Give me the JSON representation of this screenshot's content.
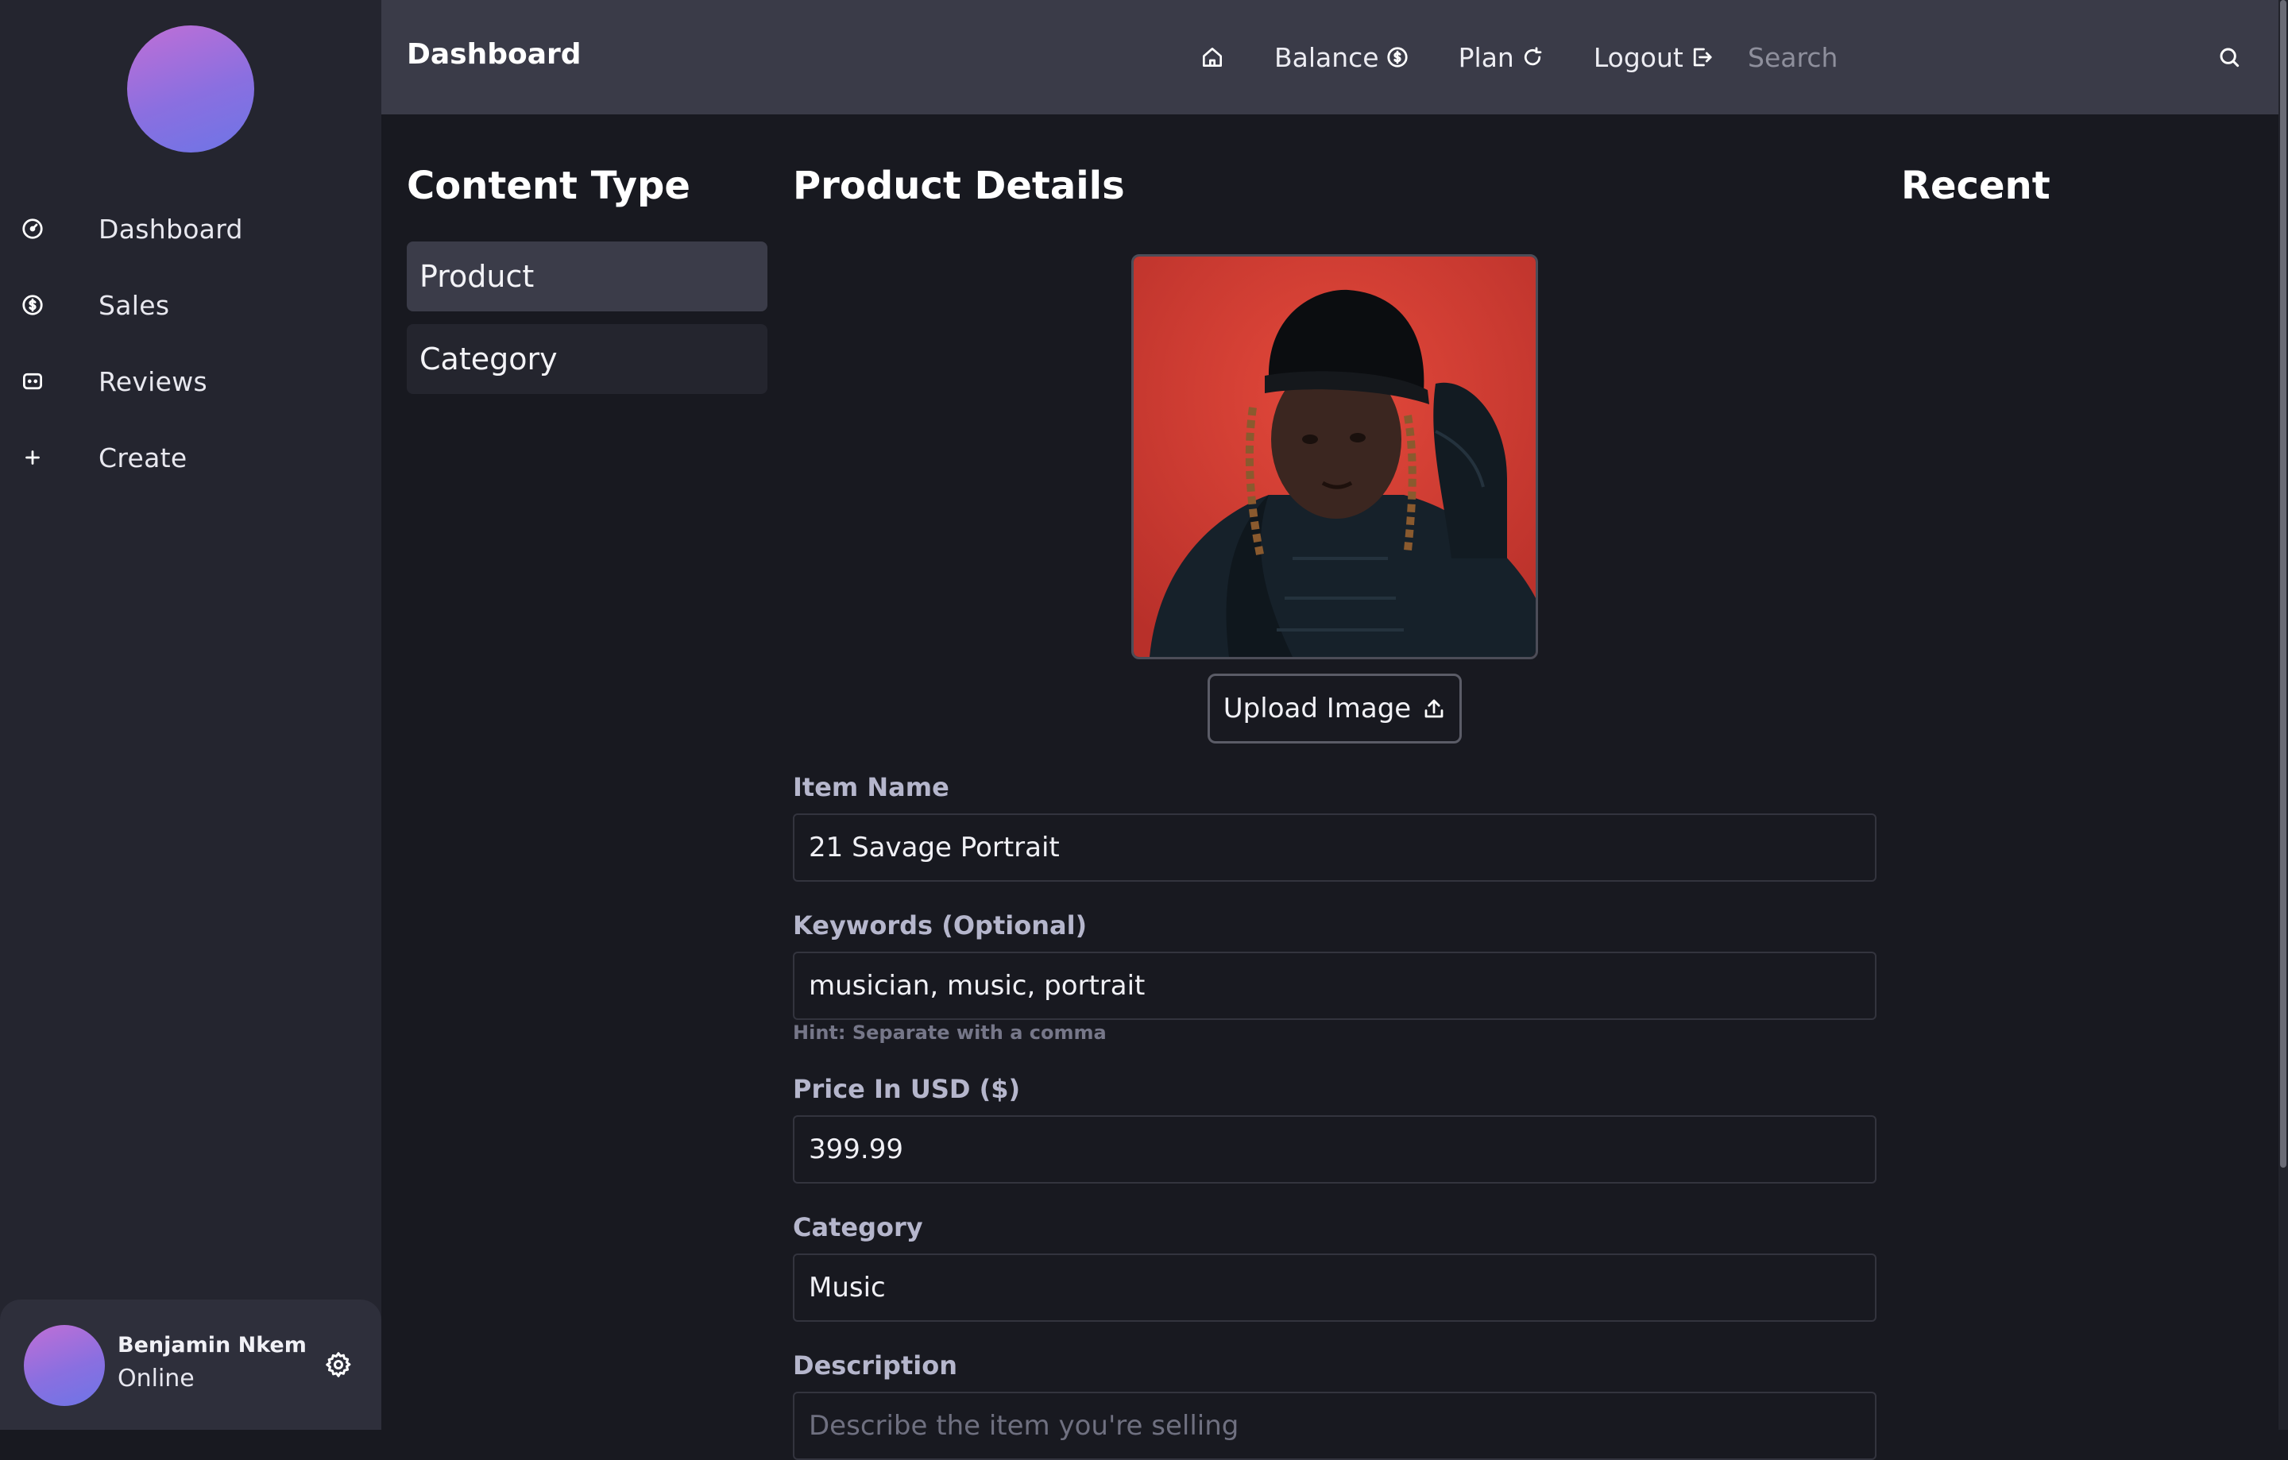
{
  "sidebar": {
    "items": [
      {
        "label": "Dashboard",
        "icon": "gauge-icon"
      },
      {
        "label": "Sales",
        "icon": "dollar-circle-icon"
      },
      {
        "label": "Reviews",
        "icon": "message-square-icon"
      },
      {
        "label": "Create",
        "icon": "plus-icon"
      }
    ],
    "user": {
      "name": "Benjamin Nkem",
      "status": "Online"
    }
  },
  "header": {
    "title": "Dashboard",
    "nav": {
      "balance": "Balance",
      "plan": "Plan",
      "logout": "Logout"
    },
    "search_placeholder": "Search"
  },
  "content_type": {
    "title": "Content Type",
    "options": [
      "Product",
      "Category"
    ],
    "selected": "Product"
  },
  "product_details": {
    "title": "Product Details",
    "upload_label": "Upload Image",
    "fields": {
      "item_name": {
        "label": "Item Name",
        "value": "21 Savage Portrait"
      },
      "keywords": {
        "label": "Keywords (Optional)",
        "value": "musician, music, portrait",
        "hint": "Hint: Separate with a comma"
      },
      "price": {
        "label": "Price In USD ($)",
        "value": "399.99"
      },
      "category": {
        "label": "Category",
        "value": "Music"
      },
      "description": {
        "label": "Description",
        "placeholder": "Describe the item you're selling"
      }
    }
  },
  "recent": {
    "title": "Recent"
  },
  "colors": {
    "background": "#181920",
    "sidebar": "#24252f",
    "topbar": "#3a3b48",
    "accent_gradient_start": "#c06fd6",
    "accent_gradient_end": "#6d75e6",
    "label": "#b5b6cc"
  }
}
